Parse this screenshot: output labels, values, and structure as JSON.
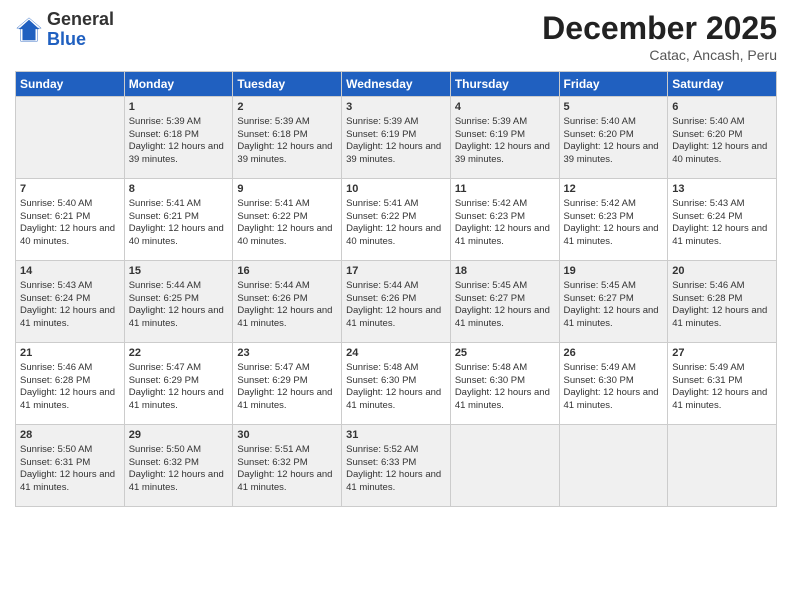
{
  "logo": {
    "general": "General",
    "blue": "Blue"
  },
  "header": {
    "month": "December 2025",
    "location": "Catac, Ancash, Peru"
  },
  "days": [
    "Sunday",
    "Monday",
    "Tuesday",
    "Wednesday",
    "Thursday",
    "Friday",
    "Saturday"
  ],
  "weeks": [
    [
      {
        "day": "",
        "sunrise": "",
        "sunset": "",
        "daylight": ""
      },
      {
        "day": "1",
        "sunrise": "Sunrise: 5:39 AM",
        "sunset": "Sunset: 6:18 PM",
        "daylight": "Daylight: 12 hours and 39 minutes."
      },
      {
        "day": "2",
        "sunrise": "Sunrise: 5:39 AM",
        "sunset": "Sunset: 6:18 PM",
        "daylight": "Daylight: 12 hours and 39 minutes."
      },
      {
        "day": "3",
        "sunrise": "Sunrise: 5:39 AM",
        "sunset": "Sunset: 6:19 PM",
        "daylight": "Daylight: 12 hours and 39 minutes."
      },
      {
        "day": "4",
        "sunrise": "Sunrise: 5:39 AM",
        "sunset": "Sunset: 6:19 PM",
        "daylight": "Daylight: 12 hours and 39 minutes."
      },
      {
        "day": "5",
        "sunrise": "Sunrise: 5:40 AM",
        "sunset": "Sunset: 6:20 PM",
        "daylight": "Daylight: 12 hours and 39 minutes."
      },
      {
        "day": "6",
        "sunrise": "Sunrise: 5:40 AM",
        "sunset": "Sunset: 6:20 PM",
        "daylight": "Daylight: 12 hours and 40 minutes."
      }
    ],
    [
      {
        "day": "7",
        "sunrise": "Sunrise: 5:40 AM",
        "sunset": "Sunset: 6:21 PM",
        "daylight": "Daylight: 12 hours and 40 minutes."
      },
      {
        "day": "8",
        "sunrise": "Sunrise: 5:41 AM",
        "sunset": "Sunset: 6:21 PM",
        "daylight": "Daylight: 12 hours and 40 minutes."
      },
      {
        "day": "9",
        "sunrise": "Sunrise: 5:41 AM",
        "sunset": "Sunset: 6:22 PM",
        "daylight": "Daylight: 12 hours and 40 minutes."
      },
      {
        "day": "10",
        "sunrise": "Sunrise: 5:41 AM",
        "sunset": "Sunset: 6:22 PM",
        "daylight": "Daylight: 12 hours and 40 minutes."
      },
      {
        "day": "11",
        "sunrise": "Sunrise: 5:42 AM",
        "sunset": "Sunset: 6:23 PM",
        "daylight": "Daylight: 12 hours and 41 minutes."
      },
      {
        "day": "12",
        "sunrise": "Sunrise: 5:42 AM",
        "sunset": "Sunset: 6:23 PM",
        "daylight": "Daylight: 12 hours and 41 minutes."
      },
      {
        "day": "13",
        "sunrise": "Sunrise: 5:43 AM",
        "sunset": "Sunset: 6:24 PM",
        "daylight": "Daylight: 12 hours and 41 minutes."
      }
    ],
    [
      {
        "day": "14",
        "sunrise": "Sunrise: 5:43 AM",
        "sunset": "Sunset: 6:24 PM",
        "daylight": "Daylight: 12 hours and 41 minutes."
      },
      {
        "day": "15",
        "sunrise": "Sunrise: 5:44 AM",
        "sunset": "Sunset: 6:25 PM",
        "daylight": "Daylight: 12 hours and 41 minutes."
      },
      {
        "day": "16",
        "sunrise": "Sunrise: 5:44 AM",
        "sunset": "Sunset: 6:26 PM",
        "daylight": "Daylight: 12 hours and 41 minutes."
      },
      {
        "day": "17",
        "sunrise": "Sunrise: 5:44 AM",
        "sunset": "Sunset: 6:26 PM",
        "daylight": "Daylight: 12 hours and 41 minutes."
      },
      {
        "day": "18",
        "sunrise": "Sunrise: 5:45 AM",
        "sunset": "Sunset: 6:27 PM",
        "daylight": "Daylight: 12 hours and 41 minutes."
      },
      {
        "day": "19",
        "sunrise": "Sunrise: 5:45 AM",
        "sunset": "Sunset: 6:27 PM",
        "daylight": "Daylight: 12 hours and 41 minutes."
      },
      {
        "day": "20",
        "sunrise": "Sunrise: 5:46 AM",
        "sunset": "Sunset: 6:28 PM",
        "daylight": "Daylight: 12 hours and 41 minutes."
      }
    ],
    [
      {
        "day": "21",
        "sunrise": "Sunrise: 5:46 AM",
        "sunset": "Sunset: 6:28 PM",
        "daylight": "Daylight: 12 hours and 41 minutes."
      },
      {
        "day": "22",
        "sunrise": "Sunrise: 5:47 AM",
        "sunset": "Sunset: 6:29 PM",
        "daylight": "Daylight: 12 hours and 41 minutes."
      },
      {
        "day": "23",
        "sunrise": "Sunrise: 5:47 AM",
        "sunset": "Sunset: 6:29 PM",
        "daylight": "Daylight: 12 hours and 41 minutes."
      },
      {
        "day": "24",
        "sunrise": "Sunrise: 5:48 AM",
        "sunset": "Sunset: 6:30 PM",
        "daylight": "Daylight: 12 hours and 41 minutes."
      },
      {
        "day": "25",
        "sunrise": "Sunrise: 5:48 AM",
        "sunset": "Sunset: 6:30 PM",
        "daylight": "Daylight: 12 hours and 41 minutes."
      },
      {
        "day": "26",
        "sunrise": "Sunrise: 5:49 AM",
        "sunset": "Sunset: 6:30 PM",
        "daylight": "Daylight: 12 hours and 41 minutes."
      },
      {
        "day": "27",
        "sunrise": "Sunrise: 5:49 AM",
        "sunset": "Sunset: 6:31 PM",
        "daylight": "Daylight: 12 hours and 41 minutes."
      }
    ],
    [
      {
        "day": "28",
        "sunrise": "Sunrise: 5:50 AM",
        "sunset": "Sunset: 6:31 PM",
        "daylight": "Daylight: 12 hours and 41 minutes."
      },
      {
        "day": "29",
        "sunrise": "Sunrise: 5:50 AM",
        "sunset": "Sunset: 6:32 PM",
        "daylight": "Daylight: 12 hours and 41 minutes."
      },
      {
        "day": "30",
        "sunrise": "Sunrise: 5:51 AM",
        "sunset": "Sunset: 6:32 PM",
        "daylight": "Daylight: 12 hours and 41 minutes."
      },
      {
        "day": "31",
        "sunrise": "Sunrise: 5:52 AM",
        "sunset": "Sunset: 6:33 PM",
        "daylight": "Daylight: 12 hours and 41 minutes."
      },
      {
        "day": "",
        "sunrise": "",
        "sunset": "",
        "daylight": ""
      },
      {
        "day": "",
        "sunrise": "",
        "sunset": "",
        "daylight": ""
      },
      {
        "day": "",
        "sunrise": "",
        "sunset": "",
        "daylight": ""
      }
    ]
  ]
}
